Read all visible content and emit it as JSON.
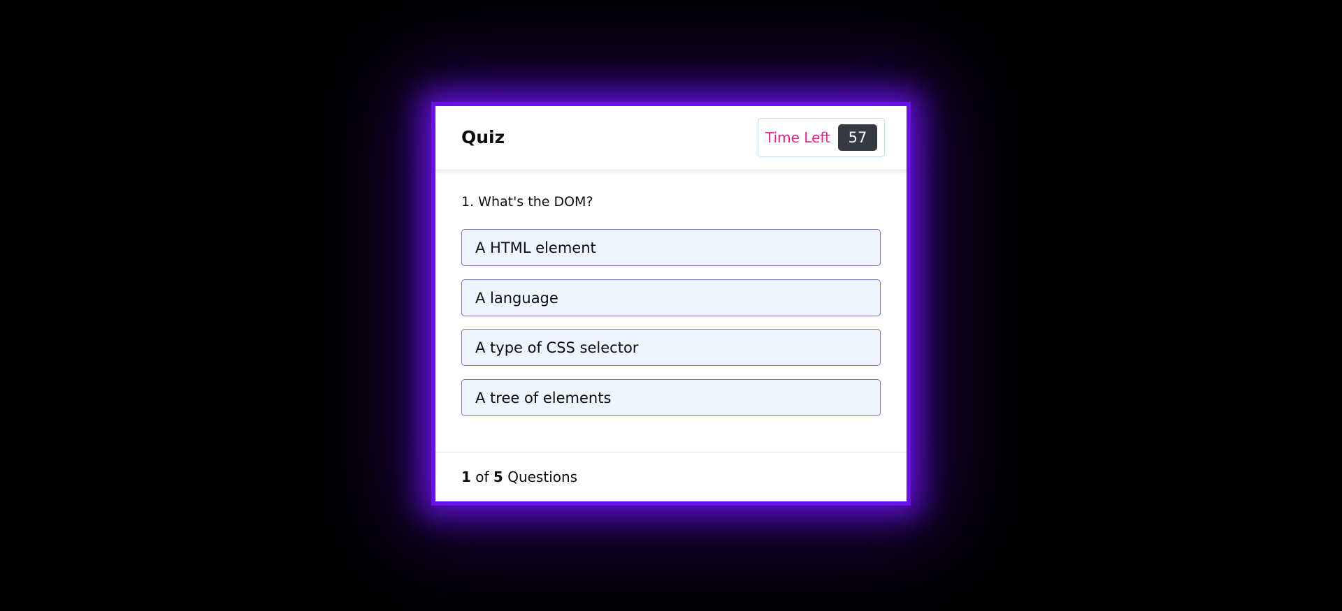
{
  "colors": {
    "page_background": "#000000",
    "accent_border": "#6a11e8",
    "timer_label": "#ea1e8a",
    "timer_badge": "#343a40",
    "option_background": "#eef5fe",
    "option_border": "#7e6fc0"
  },
  "header": {
    "title": "Quiz",
    "timer_label": "Time Left",
    "timer_seconds": "57"
  },
  "question": {
    "text": "1. What's the DOM?",
    "options": [
      "A HTML element",
      "A language",
      "A type of CSS selector",
      "A tree of elements"
    ]
  },
  "footer": {
    "current": "1",
    "of_label": "of",
    "total": "5",
    "questions_label": "Questions"
  }
}
